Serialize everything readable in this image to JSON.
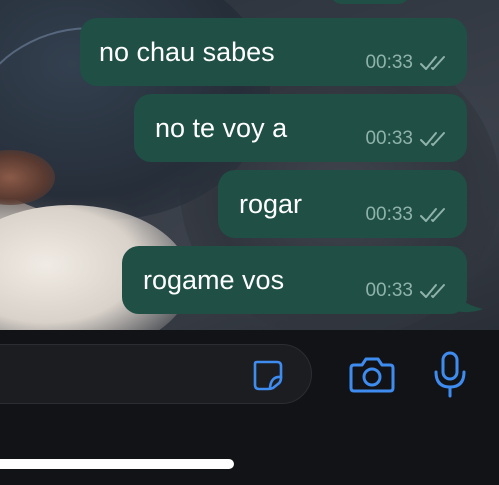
{
  "messages": [
    {
      "text": "no chau sabes",
      "time": "00:33",
      "status": "read"
    },
    {
      "text": "no te voy a",
      "time": "00:33",
      "status": "read"
    },
    {
      "text": "rogar",
      "time": "00:33",
      "status": "read"
    },
    {
      "text": "rogame vos",
      "time": "00:33",
      "status": "read"
    }
  ],
  "composer": {
    "input_value": "",
    "sticker_icon": "sticker-icon",
    "camera_icon": "camera-icon",
    "mic_icon": "microphone-icon"
  },
  "colors": {
    "bubble": "#1f4f45",
    "timestamp": "#8fb3ab",
    "accent": "#3f8cf0",
    "background": "#121316"
  }
}
